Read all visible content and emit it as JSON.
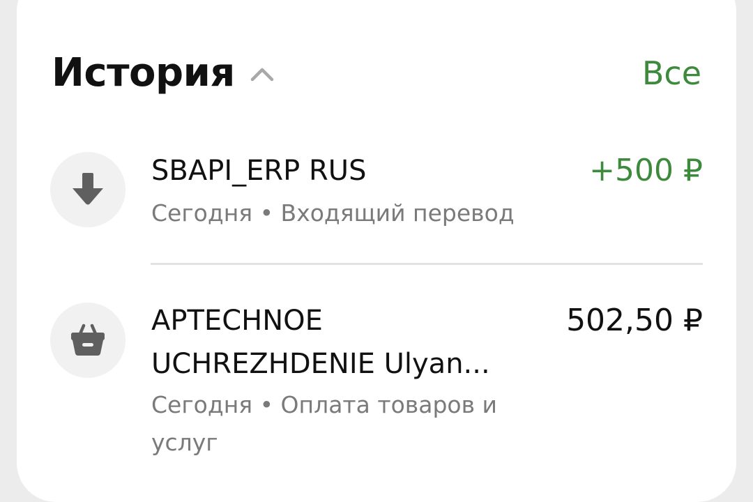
{
  "history": {
    "title": "История",
    "see_all_label": "Все"
  },
  "transactions": [
    {
      "icon": "arrow-down-icon",
      "name": "SBAPI_ERP RUS",
      "meta": "Сегодня • Входящий перевод",
      "amount": "+500 ₽",
      "amount_color": "#3d8a3d"
    },
    {
      "icon": "shopping-basket-icon",
      "name_line1": "APTECHNOE",
      "name_line2": "UCHREZHDENIE Ulyan...",
      "meta_line1": "Сегодня • Оплата товаров и",
      "meta_line2": "услуг",
      "amount": "502,50 ₽",
      "amount_color": "#111111"
    }
  ],
  "colors": {
    "accent_green": "#3d8a3d",
    "secondary_text": "#7a7a7a",
    "icon_bg": "#f1f1f1",
    "icon_fg": "#5f5f5f"
  }
}
